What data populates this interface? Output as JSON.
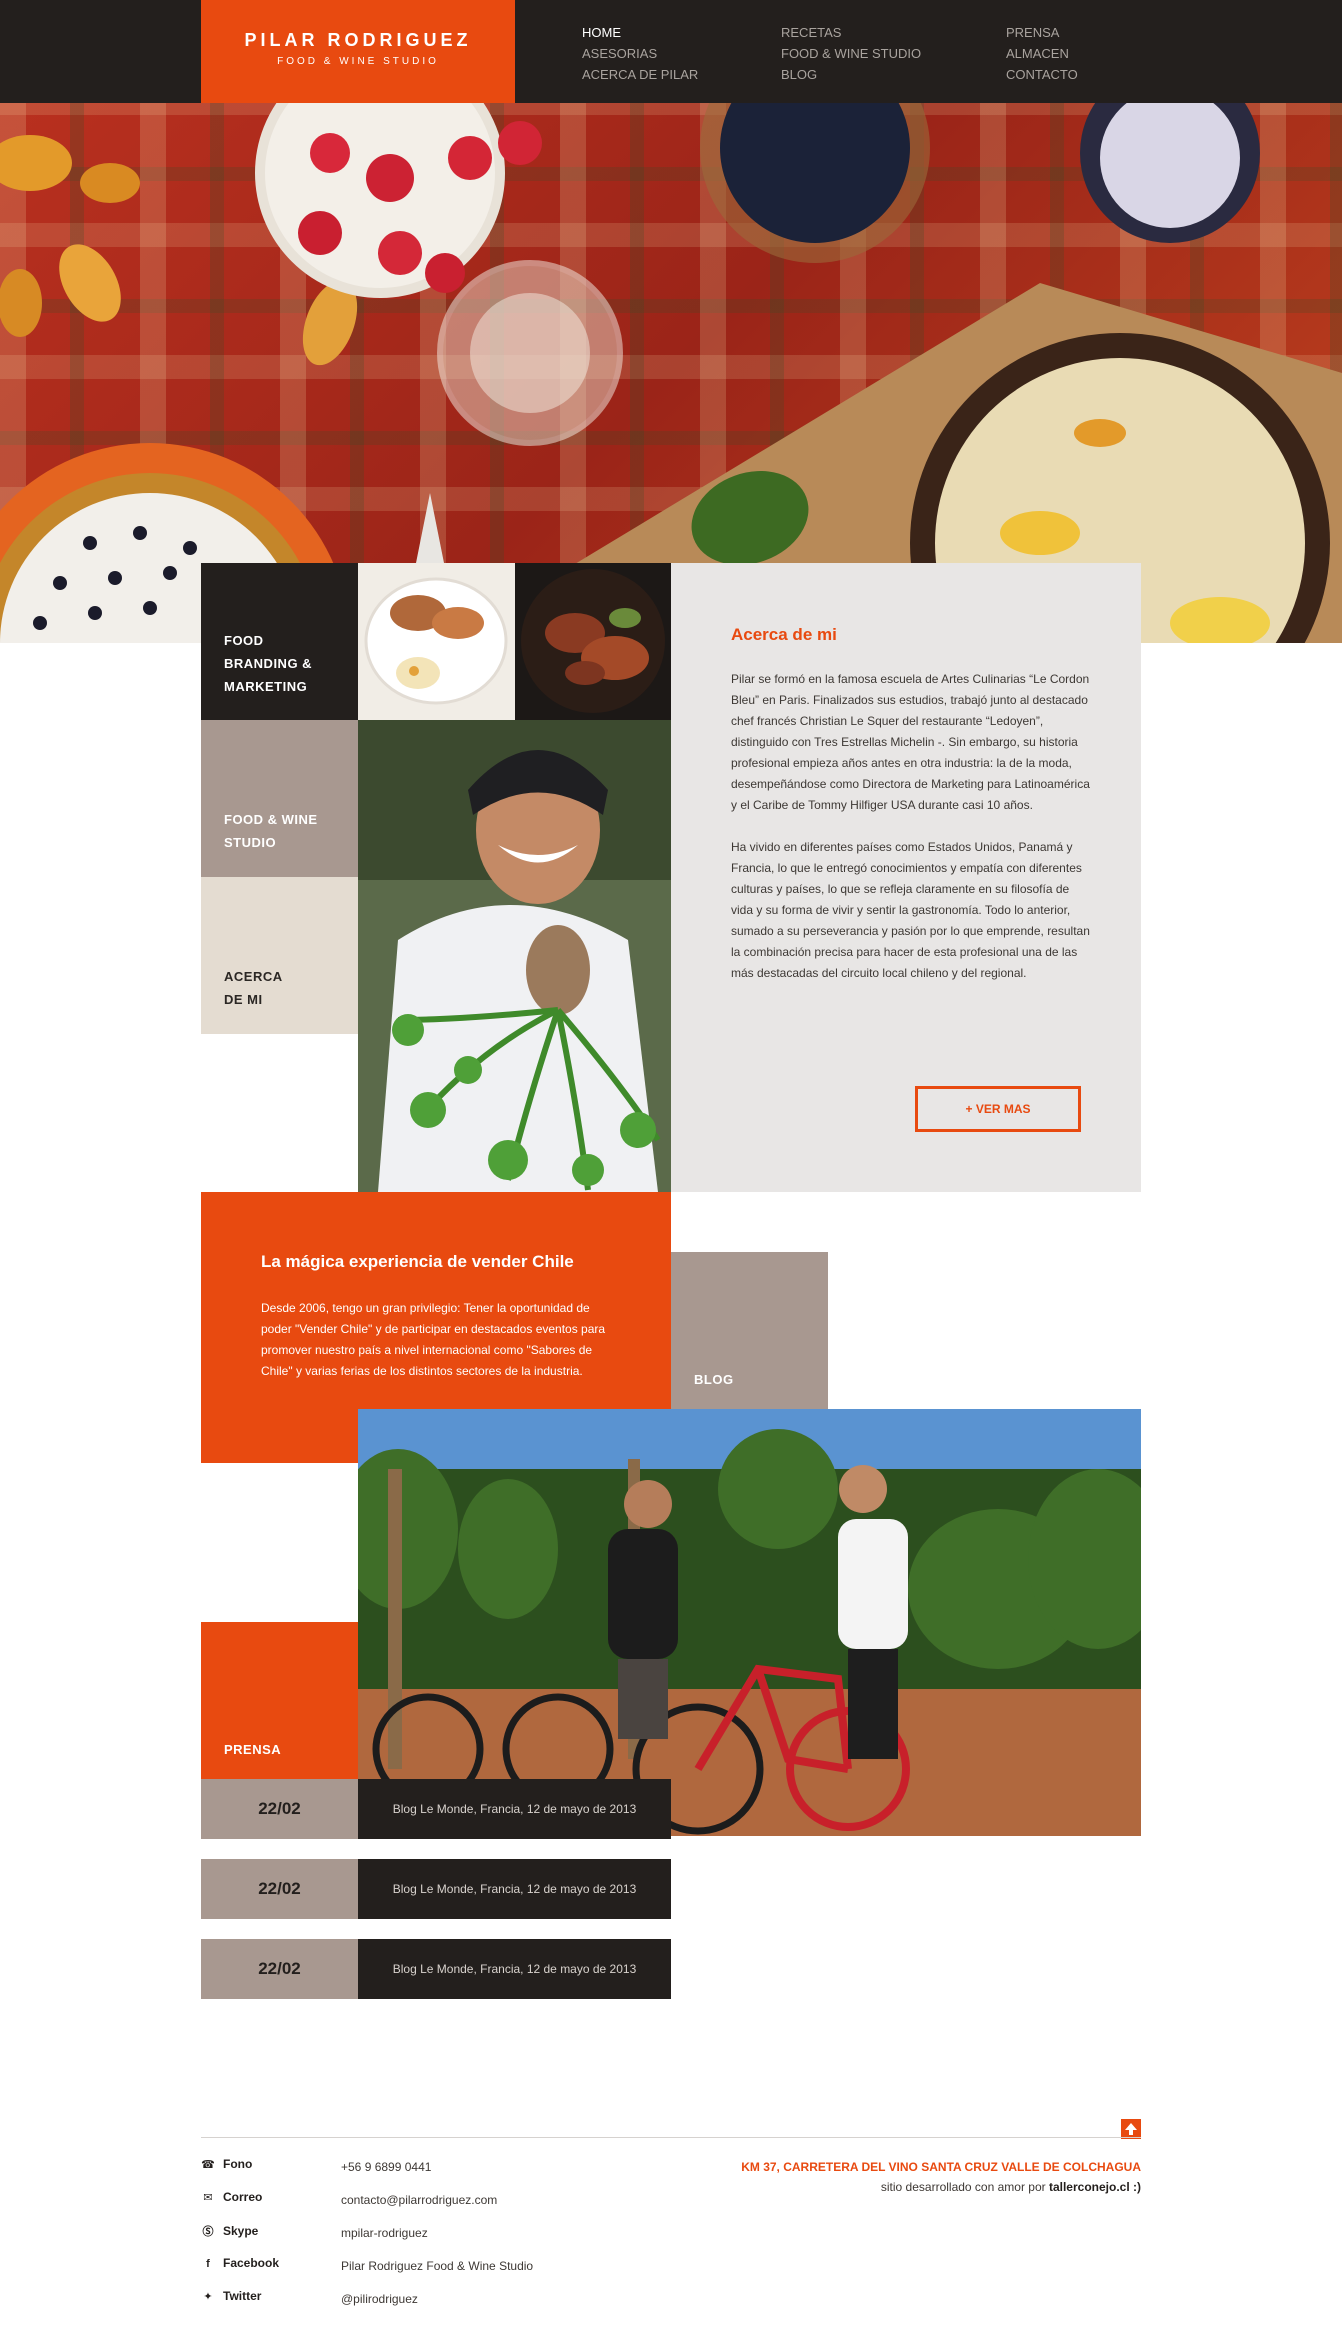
{
  "brand": {
    "name": "PILAR RODRIGUEZ",
    "tagline": "FOOD & WINE STUDIO"
  },
  "nav": {
    "col1": [
      "HOME",
      "ASESORIAS",
      "ACERCA DE PILAR"
    ],
    "col2": [
      "RECETAS",
      "FOOD & WINE STUDIO",
      "BLOG"
    ],
    "col3": [
      "PRENSA",
      "ALMACEN",
      "CONTACTO"
    ],
    "active": "HOME"
  },
  "tiles": {
    "food_branding": "FOOD BRANDING & MARKETING",
    "food_wine_studio": "FOOD & WINE STUDIO",
    "acerca": "ACERCA DE MI",
    "blog": "BLOG",
    "prensa": "PRENSA"
  },
  "about": {
    "title": "Acerca de mi",
    "p1": "Pilar se formó en la famosa escuela de Artes Culinarias “Le Cordon Bleu” en Paris. Finalizados sus estudios, trabajó junto al destacado chef francés Christian Le Squer del restaurante “Ledoyen”, distinguido con Tres Estrellas Michelin -. Sin embargo, su historia profesional empieza años antes en otra industria: la de la moda, desempeñándose como Directora de Marketing para Latinoamérica y el Caribe de Tommy Hilfiger USA durante casi 10 años.",
    "p2": "Ha vivido en diferentes países como Estados Unidos, Panamá y Francia, lo que le entregó conocimientos y empatía con diferentes culturas y países, lo que se refleja claramente en su filosofía de vida y su forma de vivir y sentir la gastronomía. Todo lo anterior, sumado a su perseverancia y pasión por lo que emprende, resultan la combinación precisa para hacer de esta profesional una de las más destacadas del circuito local chileno y del regional.",
    "button": "+ VER MAS"
  },
  "vender": {
    "title": "La mágica experiencia de vender Chile",
    "text": "Desde 2006, tengo un gran privilegio: Tener la oportunidad de poder \"Vender Chile\" y de participar en destacados eventos para promover nuestro país a nivel internacional como \"Sabores de Chile\" y varias ferias de los distintos sectores de la industria."
  },
  "press": [
    {
      "date": "22/02",
      "text": "Blog Le Monde, Francia, 12 de mayo de 2013"
    },
    {
      "date": "22/02",
      "text": "Blog Le Monde, Francia, 12 de mayo de 2013"
    },
    {
      "date": "22/02",
      "text": "Blog Le Monde, Francia, 12 de mayo de 2013"
    }
  ],
  "footer": {
    "contacts": [
      {
        "label": "Fono",
        "value": "+56 9 6899 0441",
        "icon": "phone-icon"
      },
      {
        "label": "Correo",
        "value": "contacto@pilarrodriguez.com",
        "icon": "mail-icon"
      },
      {
        "label": "Skype",
        "value": "mpilar-rodriguez",
        "icon": "skype-icon"
      },
      {
        "label": "Facebook",
        "value": "Pilar Rodriguez Food & Wine Studio",
        "icon": "facebook-icon"
      },
      {
        "label": "Twitter",
        "value": "@pilirodriguez",
        "icon": "twitter-icon"
      }
    ],
    "address": "KM 37, CARRETERA DEL VINO SANTA CRUZ VALLE DE COLCHAGUA",
    "credit_text": "sitio desarrollado con amor por",
    "credit_link": "tallerconejo.cl :)"
  },
  "colors": {
    "accent": "#e84a10",
    "dark": "#231f1d",
    "taupe": "#a89890",
    "beige": "#e4dcd1",
    "panel": "#e8e6e5"
  }
}
